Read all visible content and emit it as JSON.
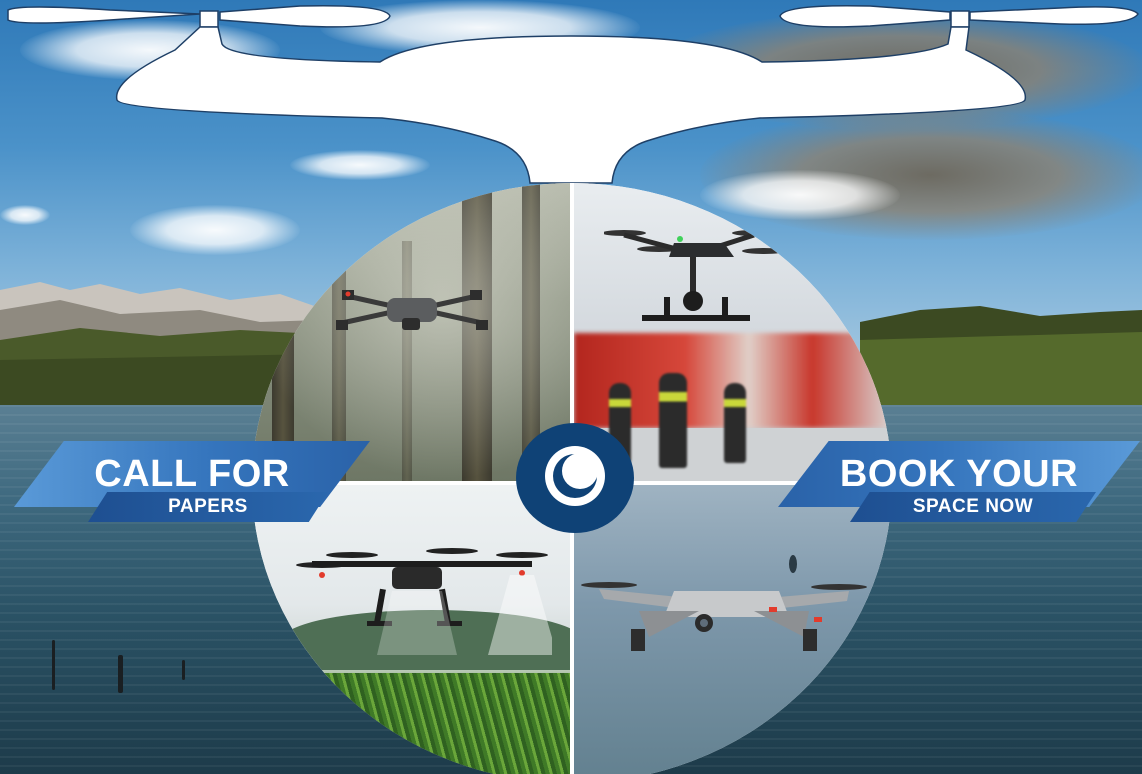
{
  "left_banner": {
    "title": "CALL FOR",
    "subtitle": "PAPERS"
  },
  "right_banner": {
    "title": "BOOK YOUR",
    "subtitle": "SPACE NOW"
  },
  "center_logo": {
    "icon": "eye-logo-icon",
    "color": "#0f4276"
  },
  "colors": {
    "banner_light": "#3575bd",
    "banner_dark": "#1e4f91",
    "drone_silhouette": "#ffffff",
    "logo_blue": "#0f4276"
  },
  "quadrants": [
    {
      "scene": "drone over misty forest"
    },
    {
      "scene": "drone over firefighters and fire truck"
    },
    {
      "scene": "agricultural drone spraying crops"
    },
    {
      "scene": "drone flying over water"
    }
  ]
}
